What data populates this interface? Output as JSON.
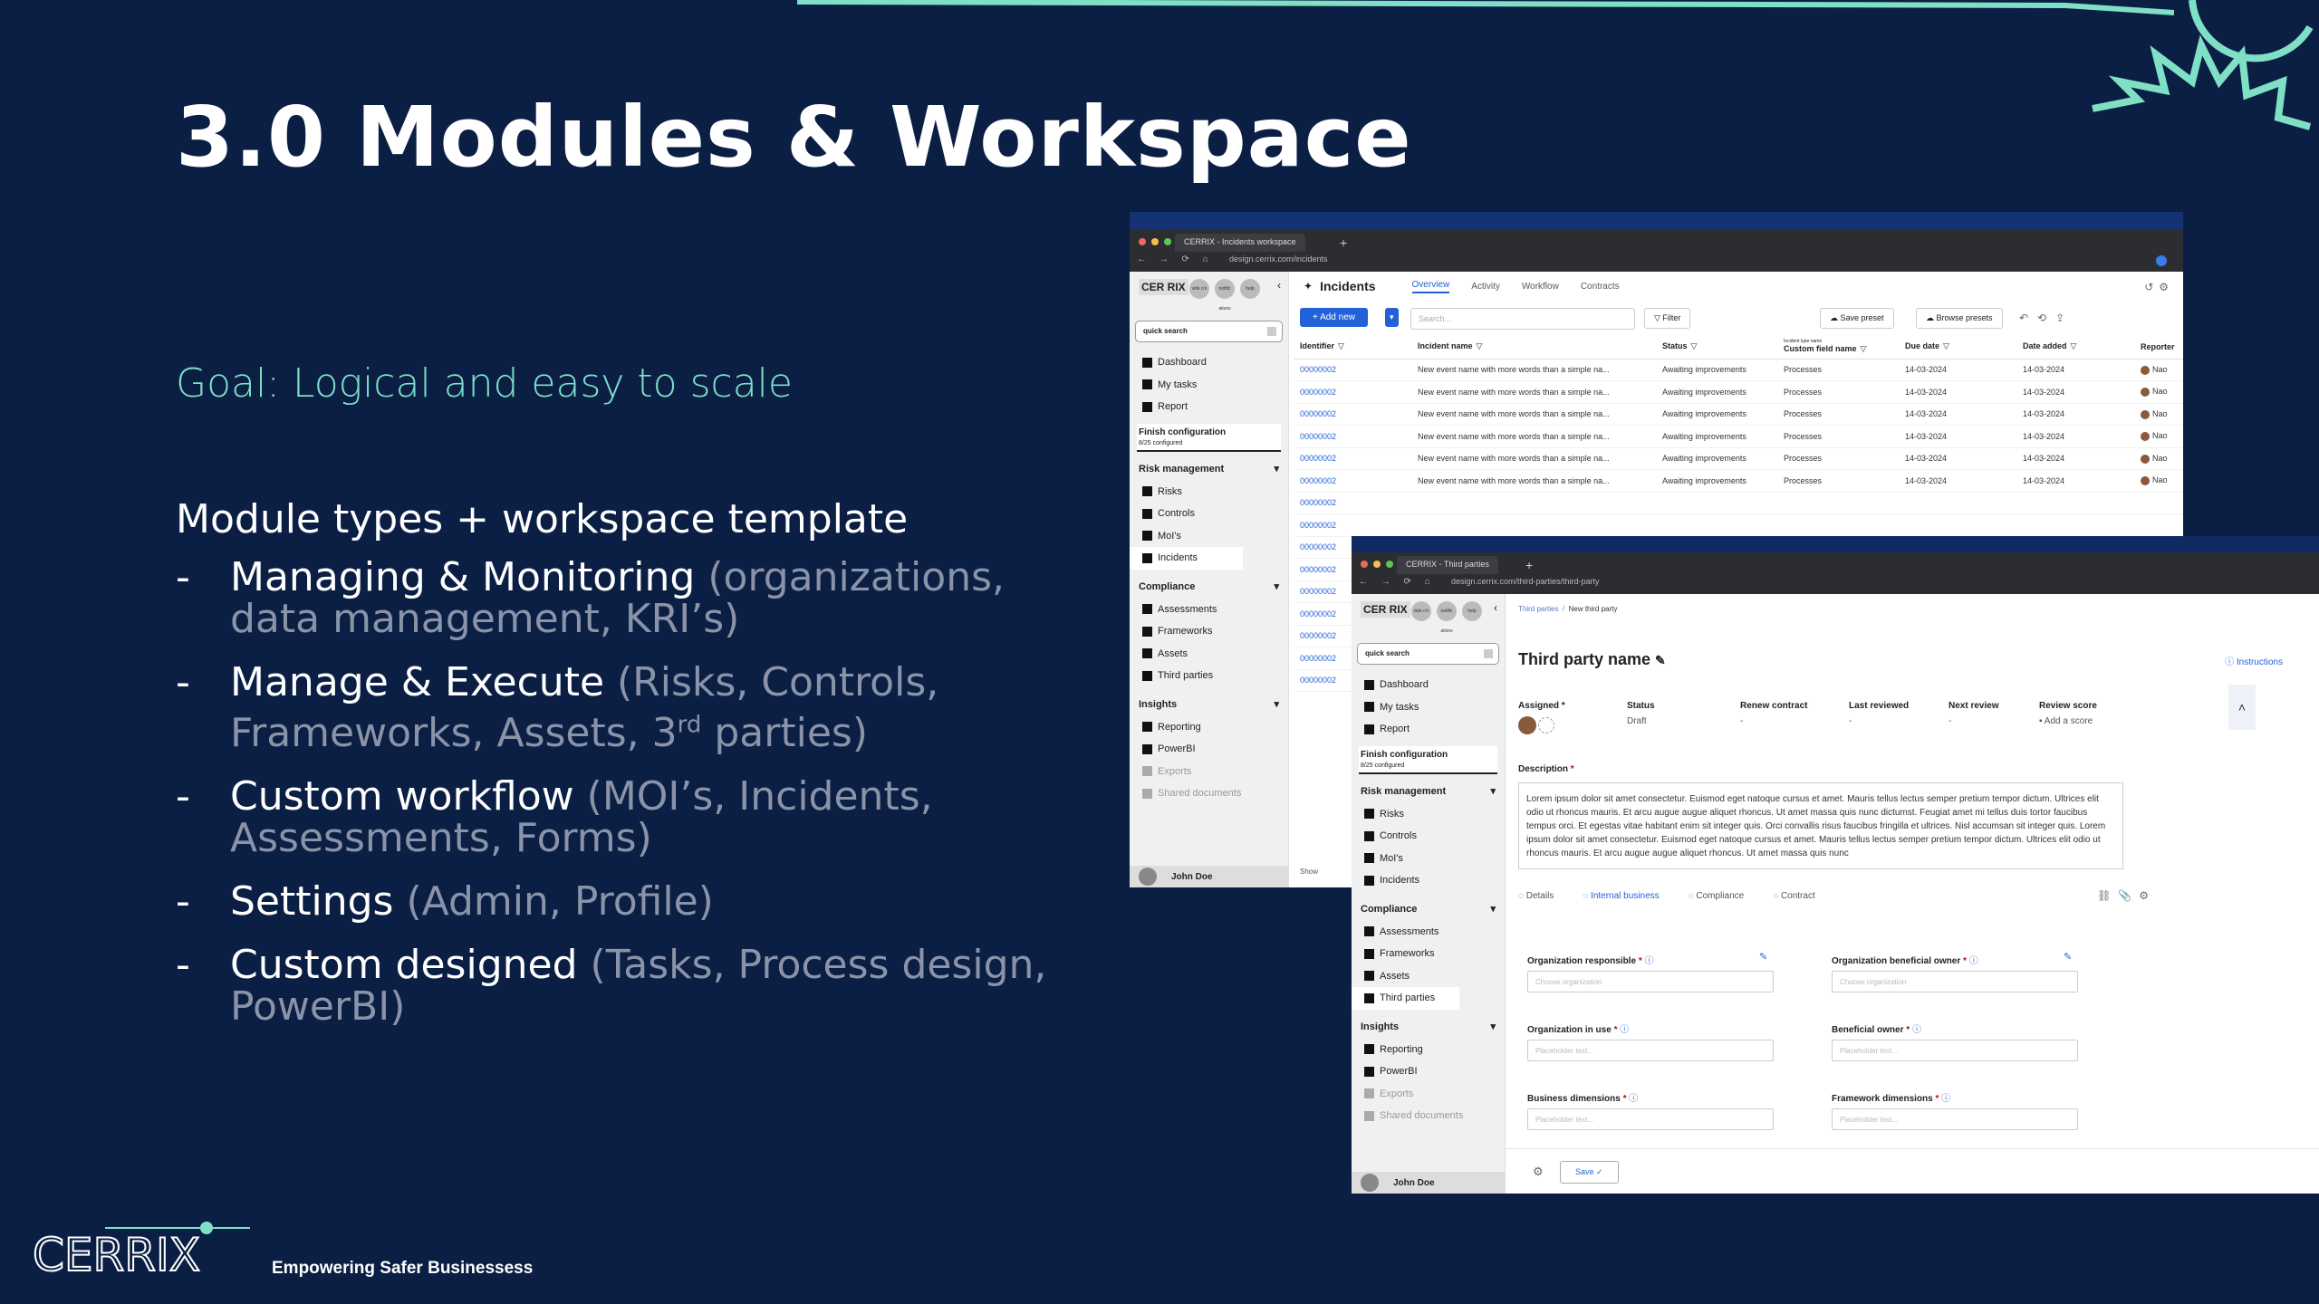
{
  "slide": {
    "title": "3.0 Modules & Workspace",
    "goal": "Goal: Logical and easy to scale",
    "module_heading": "Module types + workspace template",
    "bullets": [
      {
        "main": "Managing & Monitoring",
        "sub": "(organizations, data management, KRI’s)"
      },
      {
        "main": "Manage & Execute",
        "sub": "(Risks, Controls, Frameworks, Assets, 3",
        "sup": "rd",
        "sub_end": " parties)"
      },
      {
        "main": "Custom workflow",
        "sub": "(MOI’s, Incidents, Assessments, Forms)"
      },
      {
        "main": "Settings",
        "sub": "(Admin, Profile)"
      },
      {
        "main": "Custom designed",
        "sub": "(Tasks, Process design, PowerBI)"
      }
    ],
    "footer": {
      "logo_text": "CERRIX",
      "tagline": "Empowering Safer Businessess"
    },
    "colors": {
      "background": "#0b1f44",
      "accent": "#7fe0c6",
      "muted": "#8a93a8"
    }
  },
  "incidents_window": {
    "tab_title": "CERRIX - Incidents workspace",
    "url": "design.cerrix.com/incidents",
    "sidebar": {
      "logo": "CER RIX",
      "circles": [
        "vide o's",
        "notific ations",
        "help"
      ],
      "search_label": "quick search",
      "top_items": [
        "Dashboard",
        "My tasks",
        "Report"
      ],
      "finish_title": "Finish configuration",
      "finish_sub": "8/25 configured",
      "sections": [
        {
          "title": "Risk management",
          "items": [
            "Risks",
            "Controls",
            "MoI's",
            "Incidents"
          ]
        },
        {
          "title": "Compliance",
          "items": [
            "Assessments",
            "Frameworks",
            "Assets",
            "Third parties"
          ]
        },
        {
          "title": "Insights",
          "items": [
            "Reporting",
            "PowerBI",
            "Exports",
            "Shared documents"
          ]
        }
      ],
      "user": "John Doe"
    },
    "header": {
      "title": "Incidents",
      "tabs": [
        "Overview",
        "Activity",
        "Workflow",
        "Contracts"
      ]
    },
    "toolbar": {
      "add_new": "Add new",
      "search_placeholder": "Search...",
      "filter": "Filter",
      "save_preset": "Save preset",
      "browse_presets": "Browse presets"
    },
    "table": {
      "columns": [
        "Identifier",
        "Incident name",
        "Status",
        "Custom field name",
        "Due date",
        "Date added",
        "Reporter"
      ],
      "custom_field_caption": "Incident type name",
      "rows": [
        [
          "00000002",
          "New event name with more words than a simple na...",
          "Awaiting improvements",
          "Processes",
          "14-03-2024",
          "14-03-2024",
          "Nao"
        ],
        [
          "00000002",
          "New event name with more words than a simple na...",
          "Awaiting improvements",
          "Processes",
          "14-03-2024",
          "14-03-2024",
          "Nao"
        ],
        [
          "00000002",
          "New event name with more words than a simple na...",
          "Awaiting improvements",
          "Processes",
          "14-03-2024",
          "14-03-2024",
          "Nao"
        ],
        [
          "00000002",
          "New event name with more words than a simple na...",
          "Awaiting improvements",
          "Processes",
          "14-03-2024",
          "14-03-2024",
          "Nao"
        ],
        [
          "00000002",
          "New event name with more words than a simple na...",
          "Awaiting improvements",
          "Processes",
          "14-03-2024",
          "14-03-2024",
          "Nao"
        ],
        [
          "00000002",
          "New event name with more words than a simple na...",
          "Awaiting improvements",
          "Processes",
          "14-03-2024",
          "14-03-2024",
          "Nao"
        ],
        [
          "00000002",
          "",
          "",
          "",
          "",
          "",
          ""
        ],
        [
          "00000002",
          "",
          "",
          "",
          "",
          "",
          ""
        ],
        [
          "00000002",
          "",
          "",
          "",
          "",
          "",
          ""
        ],
        [
          "00000002",
          "",
          "",
          "",
          "",
          "",
          ""
        ],
        [
          "00000002",
          "",
          "",
          "",
          "",
          "",
          ""
        ],
        [
          "00000002",
          "",
          "",
          "",
          "",
          "",
          ""
        ],
        [
          "00000002",
          "",
          "",
          "",
          "",
          "",
          ""
        ],
        [
          "00000002",
          "",
          "",
          "",
          "",
          "",
          ""
        ],
        [
          "00000002",
          "",
          "",
          "",
          "",
          "",
          ""
        ]
      ],
      "show_label": "Show"
    }
  },
  "third_party_window": {
    "tab_title": "CERRIX - Third parties",
    "url": "design.cerrix.com/third-parties/third-party",
    "breadcrumb": [
      "Third parties",
      "New third party"
    ],
    "title": "Third party name",
    "instructions": "Instructions",
    "meta": [
      {
        "label": "Assigned *",
        "value": ""
      },
      {
        "label": "Status",
        "value": "Draft"
      },
      {
        "label": "Renew contract",
        "value": "-"
      },
      {
        "label": "Last reviewed",
        "value": "-"
      },
      {
        "label": "Next review",
        "value": "-"
      },
      {
        "label": "Review score",
        "value": "Add a score"
      }
    ],
    "description_label": "Description",
    "description_text": "Lorem ipsum dolor sit amet consectetur. Euismod eget natoque cursus et amet. Mauris tellus lectus semper pretium tempor dictum. Ultrices elit odio ut rhoncus mauris. Et arcu augue augue aliquet rhoncus. Ut amet massa quis nunc dictumst. Feugiat amet mi tellus duis tortor faucibus tempus orci. Et egestas vitae habitant enim sit integer quis. Orci convallis risus faucibus fringilla et ultrices. Nisl accumsan sit integer quis. Lorem ipsum dolor sit amet consectetur. Euismod eget natoque cursus et amet. Mauris tellus lectus semper pretium tempor dictum. Ultrices elit odio ut rhoncus mauris. Et arcu augue augue aliquet rhoncus. Ut amet massa quis nunc",
    "tabs": [
      "Details",
      "Internal business",
      "Compliance",
      "Contract"
    ],
    "fields": [
      {
        "label": "Organization responsible",
        "placeholder": "Choose organization"
      },
      {
        "label": "Organization beneficial owner",
        "placeholder": "Choose organization"
      },
      {
        "label": "Organization in use",
        "placeholder": "Placeholder text..."
      },
      {
        "label": "Beneficial owner",
        "placeholder": "Placeholder text..."
      },
      {
        "label": "Business dimensions",
        "placeholder": "Placeholder text..."
      },
      {
        "label": "Framework dimensions",
        "placeholder": "Placeholder text..."
      }
    ],
    "save": "Save",
    "sidebar": {
      "logo": "CER RIX",
      "circles": [
        "vide o's",
        "notific ations",
        "help"
      ],
      "search_label": "quick search",
      "top_items": [
        "Dashboard",
        "My tasks",
        "Report"
      ],
      "finish_title": "Finish configuration",
      "finish_sub": "8/25 configured",
      "sections": [
        {
          "title": "Risk management",
          "items": [
            "Risks",
            "Controls",
            "MoI's",
            "Incidents"
          ]
        },
        {
          "title": "Compliance",
          "items": [
            "Assessments",
            "Frameworks",
            "Assets",
            "Third parties"
          ]
        },
        {
          "title": "Insights",
          "items": [
            "Reporting",
            "PowerBI",
            "Exports",
            "Shared documents"
          ]
        }
      ],
      "user": "John Doe"
    }
  }
}
